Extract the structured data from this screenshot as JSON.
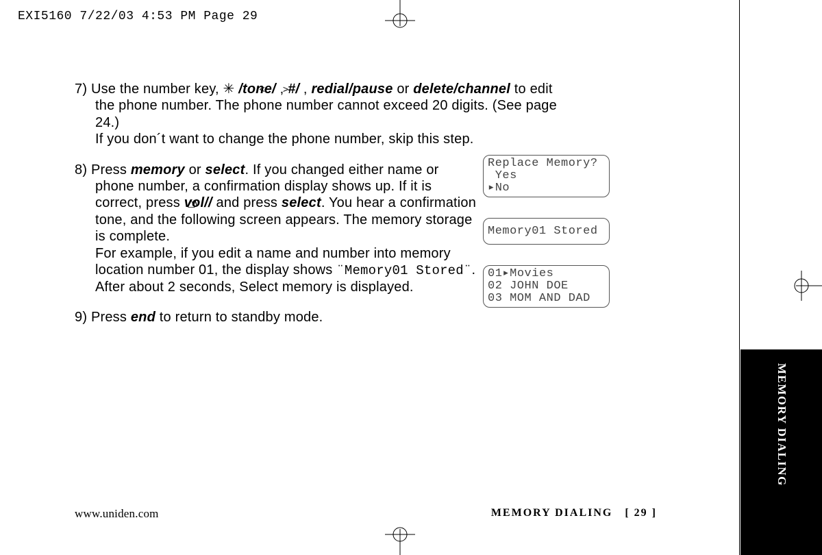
{
  "header": "EXI5160  7/22/03 4:53 PM  Page 29",
  "tab": "MEMORY DIALING",
  "step7": {
    "lead": "7) Use the number key, ",
    "k1": " /tone/ ",
    "sep1": ", ",
    "k2": "#/ ",
    "sep2": ", ",
    "k3": "redial/pause",
    "or": " or ",
    "k4": "delete/channel",
    "rest1": " to edit the phone number. The phone number cannot exceed 20 digits. (See page 24.)",
    "rest2": "If you don´t want to change the phone number, skip this step."
  },
  "step8": {
    "lead": "8) Press ",
    "k1": "memory",
    "or1": " or ",
    "k2": "select",
    "t1": ". If you changed either name or phone number, a confirmation display shows up. If it is correct, press ",
    "k3": "vol/",
    "slash": "/",
    "t2": " and press ",
    "k4": "select",
    "t3": ". You hear a confirmation tone, and the following screen appears. The memory storage is complete.",
    "t4a": "For example, if you edit a name and number into memory location number 01, the display shows ",
    "lcd_inline": "¨Memory01 Stored¨",
    "t4b": ". After about 2 seconds, Select memory is displayed."
  },
  "step9": {
    "lead": "9) Press ",
    "k1": "end",
    "rest": " to return to standby mode."
  },
  "lcd1": "Replace Memory?\n Yes\n▸No",
  "lcd2": "Memory01 Stored",
  "lcd3": "01▸Movies\n02 JOHN DOE\n03 MOM AND DAD",
  "footer": {
    "url": "www.uniden.com",
    "section": "MEMORY DIALING",
    "page": "[ 29 ]"
  }
}
